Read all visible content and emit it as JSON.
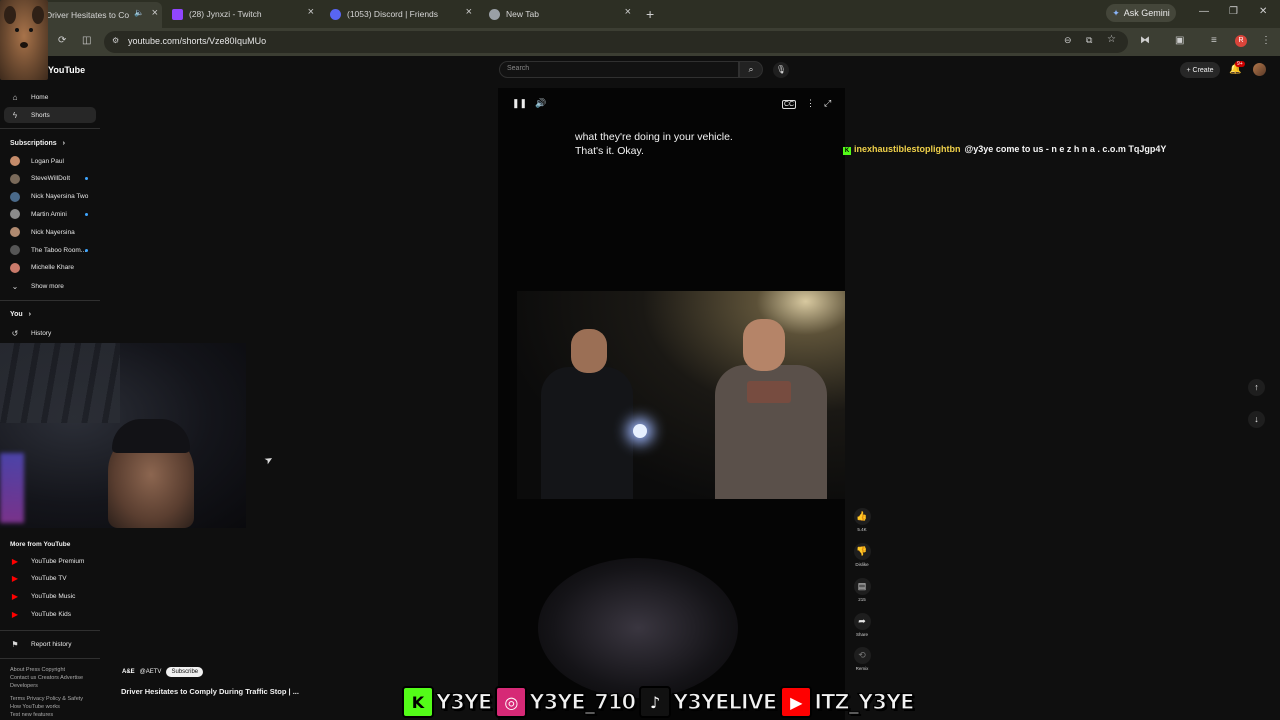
{
  "browser": {
    "tabs": [
      {
        "title": "Driver Hesitates to Co",
        "active": true
      },
      {
        "title": "(28) Jynxzi - Twitch",
        "active": false
      },
      {
        "title": "(1053) Discord | Friends",
        "active": false
      },
      {
        "title": "New Tab",
        "active": false
      }
    ],
    "ask_gemini": "Ask Gemini",
    "url": "youtube.com/shorts/Vze80IquMUo",
    "profile_initial": "R",
    "add_tab": "+"
  },
  "youtube": {
    "logo_text": "YouTube",
    "search_placeholder": "Search",
    "create_label": "Create",
    "notification_badge": "9+"
  },
  "sidebar": {
    "main": [
      {
        "label": "Home",
        "icon": "home-icon"
      },
      {
        "label": "Shorts",
        "icon": "shorts-icon",
        "active": true
      }
    ],
    "subscriptions_title": "Subscriptions",
    "subscriptions": [
      {
        "label": "Logan Paul",
        "color": "#c48b6a",
        "live": false
      },
      {
        "label": "SteveWillDoIt",
        "color": "#7a6a5a",
        "live": true
      },
      {
        "label": "Nick Nayersina Two",
        "color": "#4a6a8a",
        "live": false
      },
      {
        "label": "Martin Amini",
        "color": "#8a8a8a",
        "live": true
      },
      {
        "label": "Nick Nayersina",
        "color": "#b08a70",
        "live": false
      },
      {
        "label": "The Taboo Room...",
        "color": "#555555",
        "live": true
      },
      {
        "label": "Michelle Khare",
        "color": "#c97a6a",
        "live": false
      }
    ],
    "show_more": "Show more",
    "you_title": "You",
    "you_items": [
      {
        "label": "History",
        "icon": "history-icon"
      }
    ],
    "more_title": "More from YouTube",
    "more_items": [
      {
        "label": "YouTube Premium",
        "color": "#ff0000"
      },
      {
        "label": "YouTube TV",
        "color": "#ff0000"
      },
      {
        "label": "YouTube Music",
        "color": "#ff0000"
      },
      {
        "label": "YouTube Kids",
        "color": "#ff0000"
      }
    ],
    "report_history": "Report history",
    "footer": [
      "About  Press  Copyright",
      "Contact us  Creators  Advertise",
      "Developers",
      "Terms  Privacy  Policy & Safety",
      "How YouTube works",
      "Test new features"
    ]
  },
  "player": {
    "caption_line1": "what they're doing in your vehicle.",
    "caption_line2": "That's it. Okay."
  },
  "actions": {
    "likes": "5.4K",
    "dislike": "Dislike",
    "comments": "215",
    "share": "Share",
    "remix": "Remix"
  },
  "chat": {
    "username": "inexhaustiblestoplightbn",
    "message": "@y3ye come to us - n e z h n a . c.o.m TqJgp4Y"
  },
  "channel": {
    "handle": "@AETV",
    "subscribe": "Subscribe",
    "video_title": "Driver Hesitates to Comply During Traffic Stop | ..."
  },
  "socials": [
    {
      "platform": "kick-icon",
      "glyph": "K",
      "handle": "Y3YE",
      "color": "#53fc18"
    },
    {
      "platform": "instagram-icon",
      "glyph": "◎",
      "handle": "Y3YE_710",
      "color": "#d62976"
    },
    {
      "platform": "tiktok-icon",
      "glyph": "♪",
      "handle": "Y3YELIVE",
      "color": "#111111"
    },
    {
      "platform": "youtube-icon",
      "glyph": "▶",
      "handle": "ITZ_Y3YE",
      "color": "#ff0000"
    }
  ]
}
